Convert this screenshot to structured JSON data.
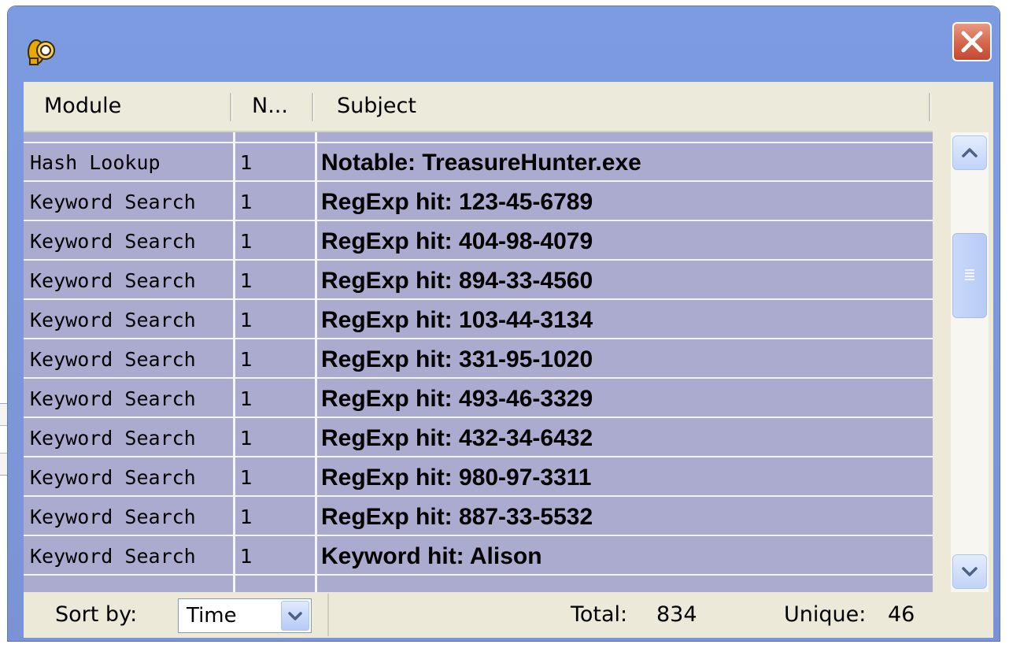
{
  "window": {
    "icon": "detective-dog-icon",
    "close_icon": "close-icon"
  },
  "columns": {
    "module": "Module",
    "count": "N...",
    "subject": "Subject"
  },
  "rows": [
    {
      "module": "Hash Lookup",
      "count": "1",
      "subject": "Notable: TreasureHunter.exe"
    },
    {
      "module": "Keyword Search",
      "count": "1",
      "subject": "RegExp hit: 123-45-6789"
    },
    {
      "module": "Keyword Search",
      "count": "1",
      "subject": "RegExp hit: 404-98-4079"
    },
    {
      "module": "Keyword Search",
      "count": "1",
      "subject": "RegExp hit: 894-33-4560"
    },
    {
      "module": "Keyword Search",
      "count": "1",
      "subject": "RegExp hit: 103-44-3134"
    },
    {
      "module": "Keyword Search",
      "count": "1",
      "subject": "RegExp hit: 331-95-1020"
    },
    {
      "module": "Keyword Search",
      "count": "1",
      "subject": "RegExp hit: 493-46-3329"
    },
    {
      "module": "Keyword Search",
      "count": "1",
      "subject": "RegExp hit: 432-34-6432"
    },
    {
      "module": "Keyword Search",
      "count": "1",
      "subject": "RegExp hit: 980-97-3311"
    },
    {
      "module": "Keyword Search",
      "count": "1",
      "subject": "RegExp hit: 887-33-5532"
    },
    {
      "module": "Keyword Search",
      "count": "1",
      "subject": "Keyword hit: Alison"
    }
  ],
  "footer": {
    "sort_label": "Sort by:",
    "sort_value": "Time",
    "total_label": "Total:",
    "total_value": "834",
    "unique_label": "Unique:",
    "unique_value": "46"
  },
  "colors": {
    "titlebar": "#7c9be0",
    "selected_row": "#ababcf",
    "client": "#ece9d8",
    "close_button": "#d6644a"
  }
}
